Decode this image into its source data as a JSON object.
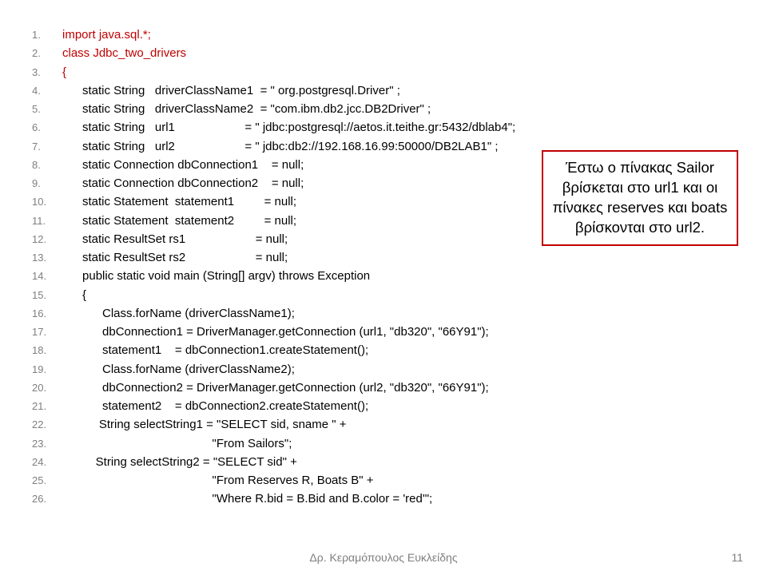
{
  "code": [
    {
      "n": "1.",
      "t": "import java.sql.*;",
      "cls": "red"
    },
    {
      "n": "2.",
      "t": "class Jdbc_two_drivers",
      "cls": "red"
    },
    {
      "n": "3.",
      "t": "{",
      "cls": "red"
    },
    {
      "n": "4.",
      "t": "      static String   driverClassName1  = \" org.postgresql.Driver\" ;"
    },
    {
      "n": "5.",
      "t": "      static String   driverClassName2  = \"com.ibm.db2.jcc.DB2Driver\" ;"
    },
    {
      "n": "6.",
      "t": "      static String   url1                     = \" jdbc:postgresql://aetos.it.teithe.gr:5432/dblab4\";"
    },
    {
      "n": "7.",
      "t": "      static String   url2                     = \" jdbc:db2://192.168.16.99:50000/DB2LAB1\" ;"
    },
    {
      "n": "8.",
      "t": "      static Connection dbConnection1    = null;"
    },
    {
      "n": "9.",
      "t": "      static Connection dbConnection2    = null;"
    },
    {
      "n": "10.",
      "t": "      static Statement  statement1         = null;"
    },
    {
      "n": "11.",
      "t": "      static Statement  statement2         = null;"
    },
    {
      "n": "12.",
      "t": "      static ResultSet rs1                     = null;"
    },
    {
      "n": "13.",
      "t": "      static ResultSet rs2                     = null;"
    },
    {
      "n": "14.",
      "t": "      public static void main (String[] argv) throws Exception"
    },
    {
      "n": "15.",
      "t": "      {"
    },
    {
      "n": "16.",
      "t": "            Class.forName (driverClassName1);"
    },
    {
      "n": "17.",
      "t": "            dbConnection1 = DriverManager.getConnection (url1, \"db320\", \"66Y91\");"
    },
    {
      "n": "18.",
      "t": "            statement1    = dbConnection1.createStatement();"
    },
    {
      "n": "19.",
      "t": "            Class.forName (driverClassName2);"
    },
    {
      "n": "20.",
      "t": "            dbConnection2 = DriverManager.getConnection (url2, \"db320\", \"66Y91\");"
    },
    {
      "n": "21.",
      "t": "            statement2    = dbConnection2.createStatement();"
    },
    {
      "n": "22.",
      "t": "           String selectString1 = \"SELECT sid, sname \" +"
    },
    {
      "n": "23.",
      "t": "                                             \"From Sailors\";"
    },
    {
      "n": "24.",
      "t": "          String selectString2 = \"SELECT sid\" +"
    },
    {
      "n": "25.",
      "t": "                                             \"From Reserves R, Boats B\" +"
    },
    {
      "n": "26.",
      "t": "                                             \"Where R.bid = B.Bid and B.color = 'red'\";"
    }
  ],
  "callout": "Έστω ο πίνακας Sailor βρίσκεται στο url1 και οι πίνακες reserves και boats βρίσκονται στο url2.",
  "footer": "Δρ. Κεραμόπουλος Ευκλείδης",
  "pagenum": "11"
}
